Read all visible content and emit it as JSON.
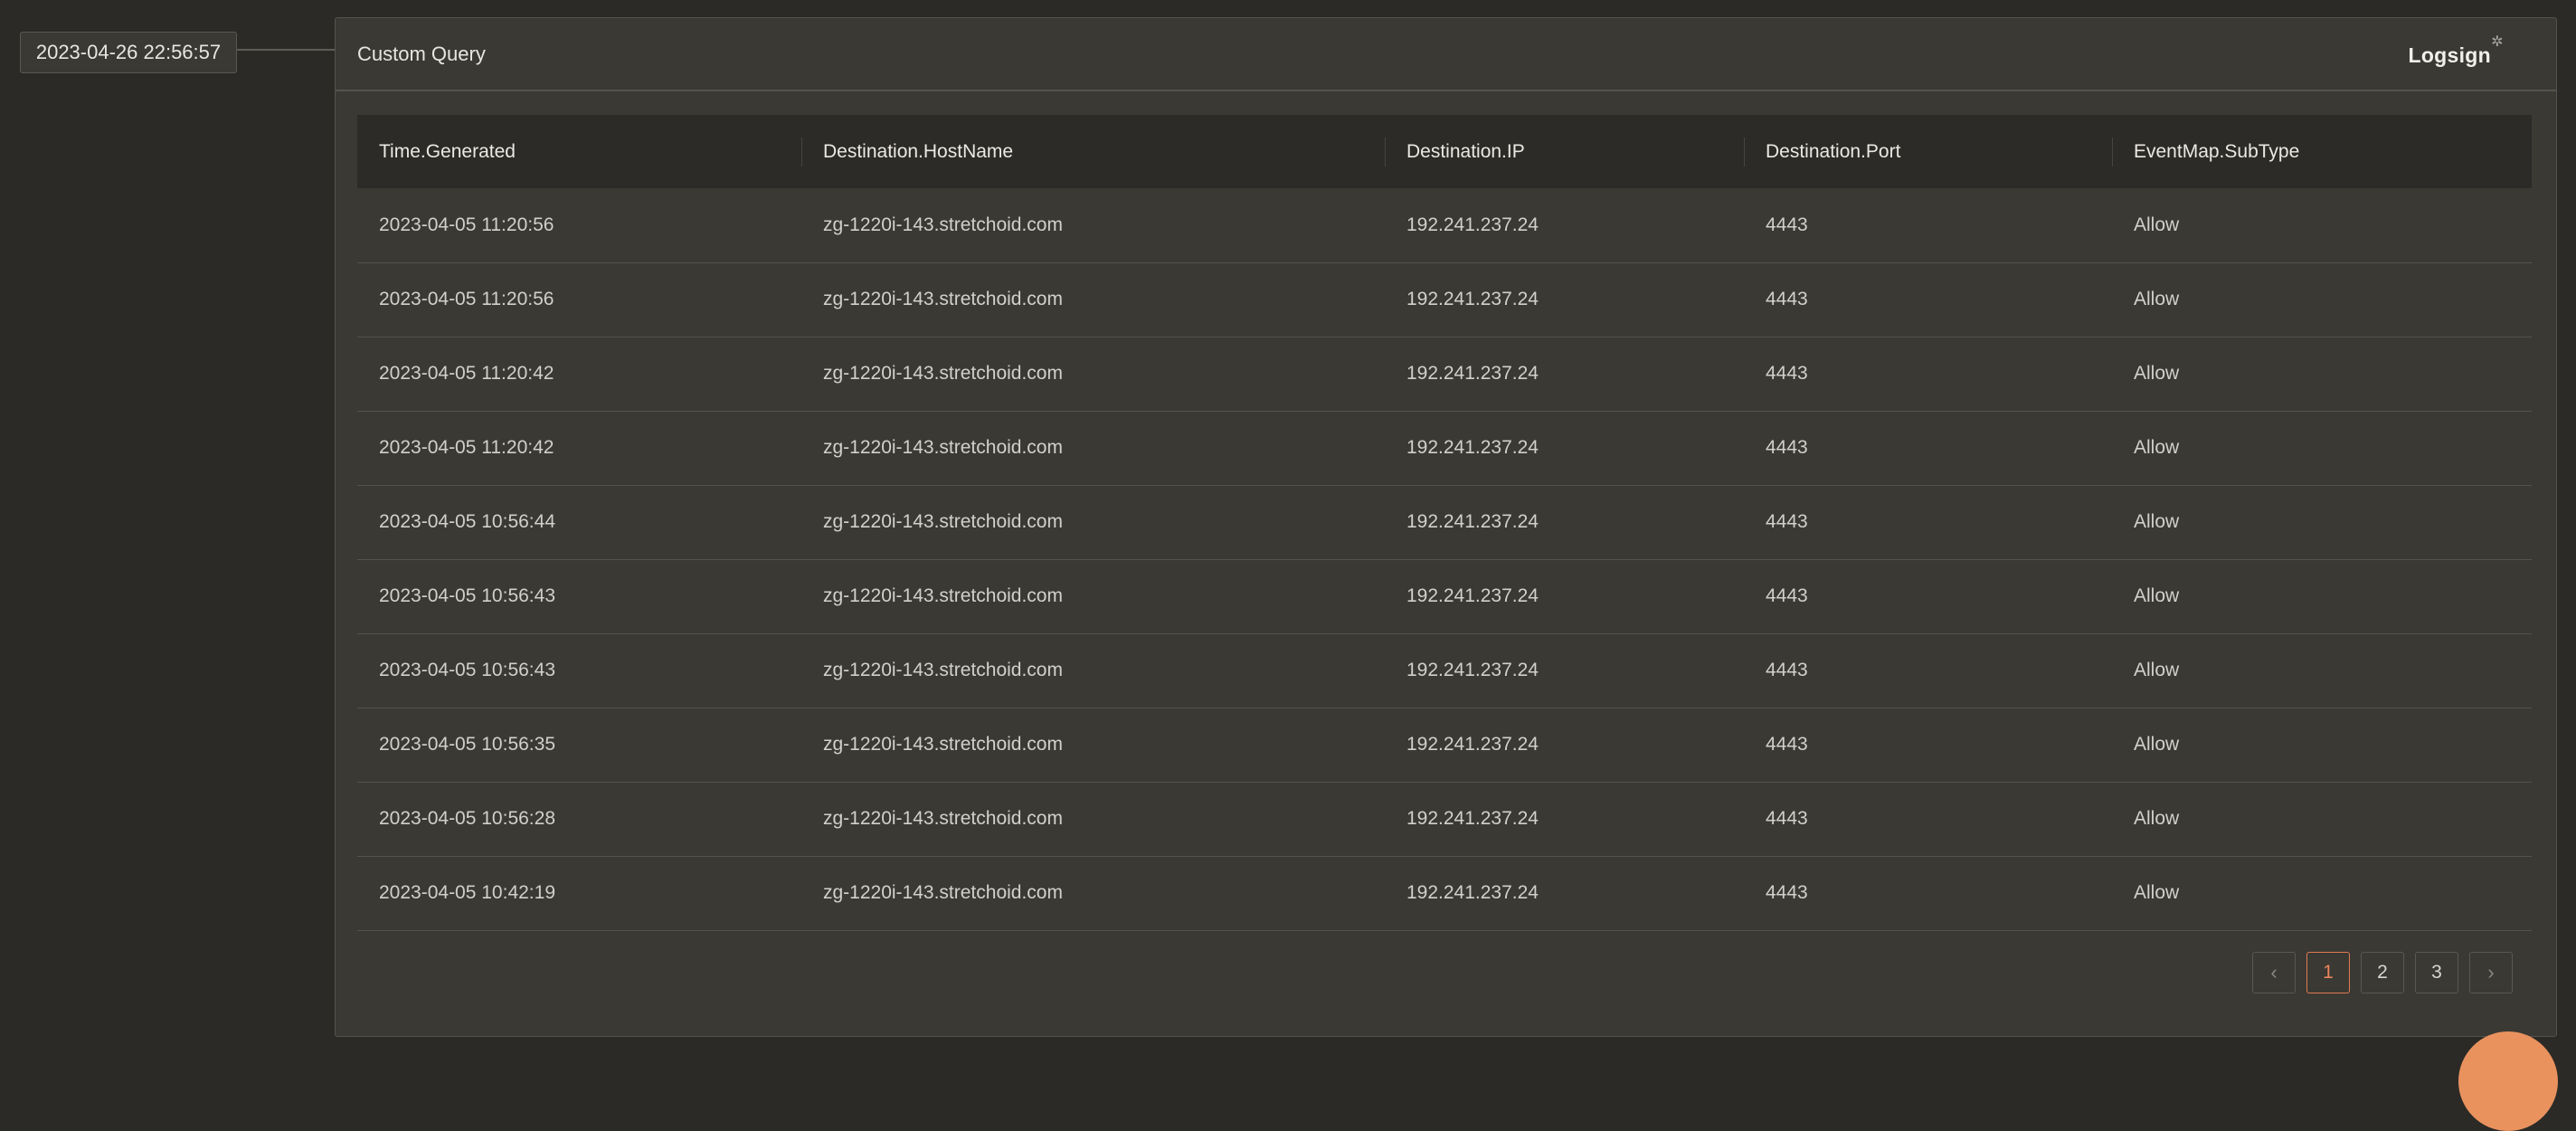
{
  "timestamp": "2023-04-26 22:56:57",
  "panel": {
    "title": "Custom Query",
    "logo_text": "Logsign",
    "logo_mark": "✲"
  },
  "table": {
    "columns": [
      "Time.Generated",
      "Destination.HostName",
      "Destination.IP",
      "Destination.Port",
      "EventMap.SubType"
    ],
    "rows": [
      [
        "2023-04-05 11:20:56",
        "zg-1220i-143.stretchoid.com",
        "192.241.237.24",
        "4443",
        "Allow"
      ],
      [
        "2023-04-05 11:20:56",
        "zg-1220i-143.stretchoid.com",
        "192.241.237.24",
        "4443",
        "Allow"
      ],
      [
        "2023-04-05 11:20:42",
        "zg-1220i-143.stretchoid.com",
        "192.241.237.24",
        "4443",
        "Allow"
      ],
      [
        "2023-04-05 11:20:42",
        "zg-1220i-143.stretchoid.com",
        "192.241.237.24",
        "4443",
        "Allow"
      ],
      [
        "2023-04-05 10:56:44",
        "zg-1220i-143.stretchoid.com",
        "192.241.237.24",
        "4443",
        "Allow"
      ],
      [
        "2023-04-05 10:56:43",
        "zg-1220i-143.stretchoid.com",
        "192.241.237.24",
        "4443",
        "Allow"
      ],
      [
        "2023-04-05 10:56:43",
        "zg-1220i-143.stretchoid.com",
        "192.241.237.24",
        "4443",
        "Allow"
      ],
      [
        "2023-04-05 10:56:35",
        "zg-1220i-143.stretchoid.com",
        "192.241.237.24",
        "4443",
        "Allow"
      ],
      [
        "2023-04-05 10:56:28",
        "zg-1220i-143.stretchoid.com",
        "192.241.237.24",
        "4443",
        "Allow"
      ],
      [
        "2023-04-05 10:42:19",
        "zg-1220i-143.stretchoid.com",
        "192.241.237.24",
        "4443",
        "Allow"
      ]
    ]
  },
  "pagination": {
    "prev_icon": "chevron-left-icon",
    "next_icon": "chevron-right-icon",
    "prev_glyph": "‹",
    "next_glyph": "›",
    "pages": [
      "1",
      "2",
      "3"
    ],
    "current_page": "1"
  },
  "colors": {
    "background": "#2b2a26",
    "panel": "#3a3934",
    "header_row": "#2c2b28",
    "accent": "#e07a52",
    "fab": "#e9925e"
  }
}
